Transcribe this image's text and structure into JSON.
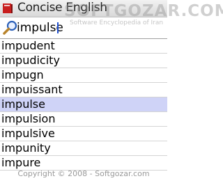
{
  "app": {
    "title": "Concise English"
  },
  "watermark": {
    "logo": "SOFTGOZAR.COM",
    "subtitle": "Software Encyclopedia of Iran"
  },
  "search": {
    "value": "impulse",
    "placeholder": ""
  },
  "results": [
    {
      "word": "impudent"
    },
    {
      "word": "impudicity"
    },
    {
      "word": "impugn"
    },
    {
      "word": "impuissant"
    },
    {
      "word": "impulse",
      "selected": true
    },
    {
      "word": "impulsion"
    },
    {
      "word": "impulsive"
    },
    {
      "word": "impunity"
    },
    {
      "word": "impure"
    }
  ],
  "footer": {
    "text": "Copyright © 2008 - Softgozar.com"
  },
  "colors": {
    "selected_row": "#cfd3f7",
    "caret": "#2050d0"
  },
  "icons": {
    "app": "book-icon",
    "search": "magnifier-icon"
  }
}
